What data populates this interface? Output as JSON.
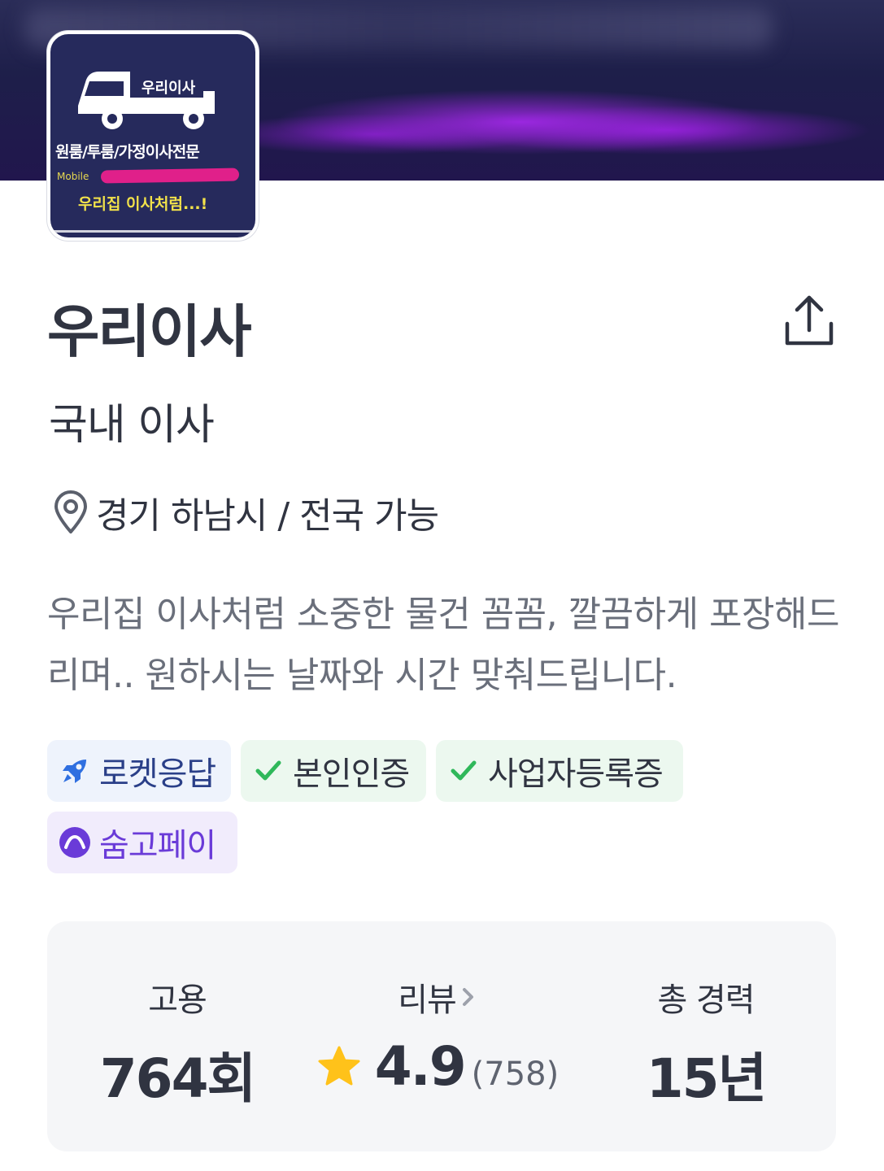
{
  "banner": {},
  "logo": {
    "brand": "우리이사",
    "tagline": "원룸/투룸/가정이사전문",
    "mobile_label": "Mobile",
    "slogan": "우리집 이사처럼...!"
  },
  "profile": {
    "name": "우리이사",
    "category": "국내 이사",
    "location": "경기 하남시 / 전국 가능",
    "description": "우리집 이사처럼 소중한 물건 꼼꼼, 깔끔하게  포장해드리며.. 원하시는 날짜와 시간 맞춰드립니다."
  },
  "badges": {
    "rocket": "로켓응답",
    "identity": "본인인증",
    "business": "사업자등록증",
    "pay": "숨고페이"
  },
  "stats": {
    "hire_label": "고용",
    "hire_value": "764회",
    "review_label": "리뷰",
    "rating": "4.9",
    "review_count": "(758)",
    "career_label": "총 경력",
    "career_value": "15년"
  },
  "colors": {
    "text_primary": "#303441",
    "text_secondary": "#6a6f7b",
    "check_green": "#2fb85a",
    "rocket_blue": "#2f6fe0",
    "pay_purple": "#6a3bd8",
    "star_yellow": "#ffc21a"
  },
  "icons": {
    "share": "share-icon",
    "location": "location-pin-icon",
    "rocket": "rocket-icon",
    "check": "check-icon",
    "pay": "soomgo-pay-icon",
    "star": "star-icon",
    "chevron": "chevron-right-icon"
  }
}
